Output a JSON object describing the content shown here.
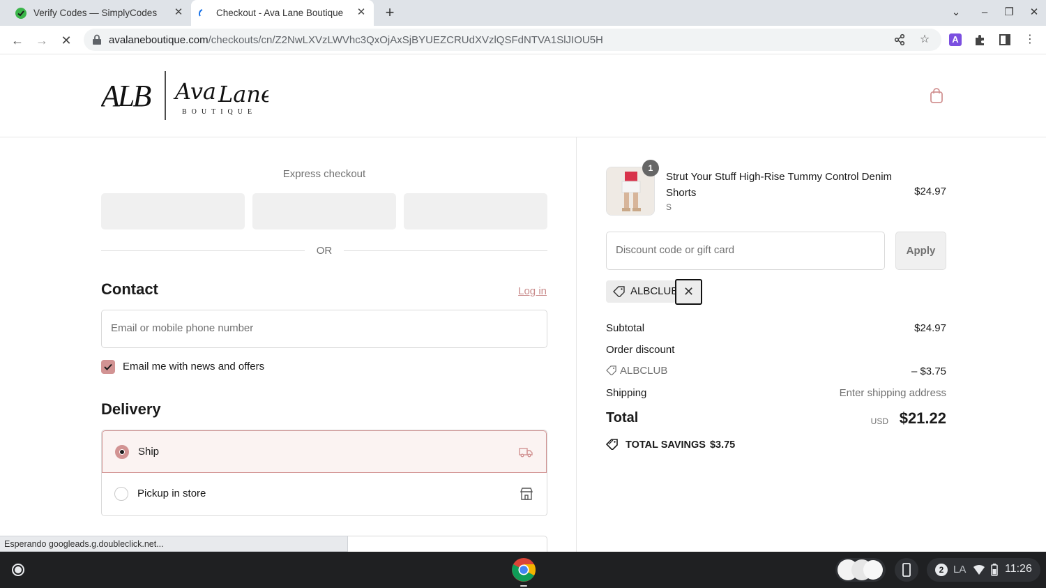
{
  "browser": {
    "tabs": [
      {
        "title": "Verify Codes — SimplyCodes",
        "active": false
      },
      {
        "title": "Checkout - Ava Lane Boutique",
        "active": true
      }
    ],
    "url_host": "avalaneboutique.com",
    "url_path": "/checkouts/cn/Z2NwLXVzLWVhc3QxOjAxSjBYUEZCRUdXVzlQSFdNTVA1SlJIOU5H",
    "status_text": "Esperando googleads.g.doubleclick.net..."
  },
  "header": {
    "logo_text": "ALB | Ava Lane BOUTIQUE"
  },
  "checkout": {
    "express_label": "Express checkout",
    "or_text": "OR",
    "contact_heading": "Contact",
    "login_link": "Log in",
    "email_placeholder": "Email or mobile phone number",
    "newsletter_label": "Email me with news and offers",
    "newsletter_checked": true,
    "delivery_heading": "Delivery",
    "delivery_options": [
      {
        "label": "Ship",
        "selected": true,
        "icon": "truck-icon"
      },
      {
        "label": "Pickup in store",
        "selected": false,
        "icon": "store-icon"
      }
    ]
  },
  "summary": {
    "item": {
      "name": "Strut Your Stuff High-Rise Tummy Control Denim Shorts",
      "variant": "S",
      "price": "$24.97",
      "quantity": "1"
    },
    "discount_placeholder": "Discount code or gift card",
    "apply_label": "Apply",
    "applied_code": "ALBCLUB",
    "subtotal_label": "Subtotal",
    "subtotal_value": "$24.97",
    "order_discount_label": "Order discount",
    "discount_code_line": "ALBCLUB",
    "discount_value": "– $3.75",
    "shipping_label": "Shipping",
    "shipping_value": "Enter shipping address",
    "total_label": "Total",
    "total_currency": "USD",
    "total_value": "$21.22",
    "savings_label": "TOTAL SAVINGS",
    "savings_value": "$3.75"
  },
  "shelf": {
    "notification_count": "2",
    "ime": "LA",
    "time": "11:26"
  },
  "colors": {
    "accent": "#d29393",
    "accent_bg": "#fbf3f2"
  }
}
